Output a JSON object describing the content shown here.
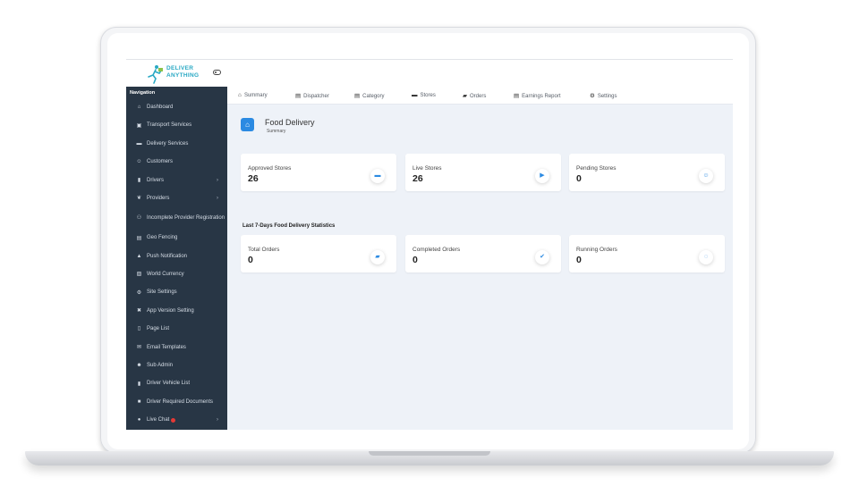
{
  "brand": {
    "line1": "DELIVER",
    "line2": "ANYTHING",
    "color": "#2aa9c4"
  },
  "sidebar": {
    "title": "Navigation",
    "items": [
      {
        "label": "Dashboard",
        "icon": "home-icon",
        "glyph": "⌂"
      },
      {
        "label": "Transport Services",
        "icon": "truck-icon",
        "glyph": "▣"
      },
      {
        "label": "Delivery Services",
        "icon": "box-icon",
        "glyph": "▬"
      },
      {
        "label": "Customers",
        "icon": "users-icon",
        "glyph": "☺"
      },
      {
        "label": "Drivers",
        "icon": "car-icon",
        "glyph": "▮",
        "chevron": "›"
      },
      {
        "label": "Providers",
        "icon": "handshake-icon",
        "glyph": "❦",
        "chevron": "›"
      },
      {
        "label": "Incomplete Provider Registration",
        "icon": "user-warning-icon",
        "glyph": "⚇"
      },
      {
        "label": "Geo Fencing",
        "icon": "map-icon",
        "glyph": "▤"
      },
      {
        "label": "Push Notification",
        "icon": "bell-icon",
        "glyph": "▲"
      },
      {
        "label": "World Currency",
        "icon": "money-icon",
        "glyph": "▧"
      },
      {
        "label": "Site Settings",
        "icon": "cogs-icon",
        "glyph": "⚙"
      },
      {
        "label": "App Version Setting",
        "icon": "tools-icon",
        "glyph": "✖"
      },
      {
        "label": "Page List",
        "icon": "file-icon",
        "glyph": "▯"
      },
      {
        "label": "Email Templates",
        "icon": "envelope-icon",
        "glyph": "✉"
      },
      {
        "label": "Sub Admin",
        "icon": "user-cog-icon",
        "glyph": "☻"
      },
      {
        "label": "Driver Vehicle List",
        "icon": "car-icon",
        "glyph": "▮"
      },
      {
        "label": "Driver Required Documents",
        "icon": "document-icon",
        "glyph": "■"
      },
      {
        "label": "Live Chat",
        "icon": "chat-icon",
        "glyph": "●",
        "chevron": "›",
        "dot_color": "#e53935"
      }
    ],
    "bg": "#283645"
  },
  "tabs": [
    {
      "label": "Summary",
      "icon": "home-icon",
      "glyph": "⌂"
    },
    {
      "label": "Dispatcher",
      "icon": "list-icon",
      "glyph": "▤"
    },
    {
      "label": "Category",
      "icon": "list-icon",
      "glyph": "▤"
    },
    {
      "label": "Stores",
      "icon": "store-icon",
      "glyph": "▬"
    },
    {
      "label": "Orders",
      "icon": "bag-icon",
      "glyph": "▰"
    },
    {
      "label": "Earnings Report",
      "icon": "report-icon",
      "glyph": "▤"
    },
    {
      "label": "Settings",
      "icon": "gear-icon",
      "glyph": "⚙"
    }
  ],
  "page": {
    "title": "Food Delivery",
    "subtitle": "Summary",
    "accent": "#2b8ae2"
  },
  "store_cards": [
    {
      "label": "Approved Stores",
      "value": "26",
      "icon": "store-icon",
      "glyph": "▬"
    },
    {
      "label": "Live Stores",
      "value": "26",
      "icon": "truck-icon",
      "glyph": "▶"
    },
    {
      "label": "Pending Stores",
      "value": "0",
      "icon": "user-plus-icon",
      "glyph": "☺"
    }
  ],
  "stats_title": "Last 7-Days Food Delivery Statistics",
  "order_cards": [
    {
      "label": "Total Orders",
      "value": "0",
      "icon": "bag-icon",
      "glyph": "▰"
    },
    {
      "label": "Completed Orders",
      "value": "0",
      "icon": "check-icon",
      "glyph": "✔"
    },
    {
      "label": "Running Orders",
      "value": "0",
      "icon": "spinner-icon",
      "glyph": "◌"
    }
  ]
}
